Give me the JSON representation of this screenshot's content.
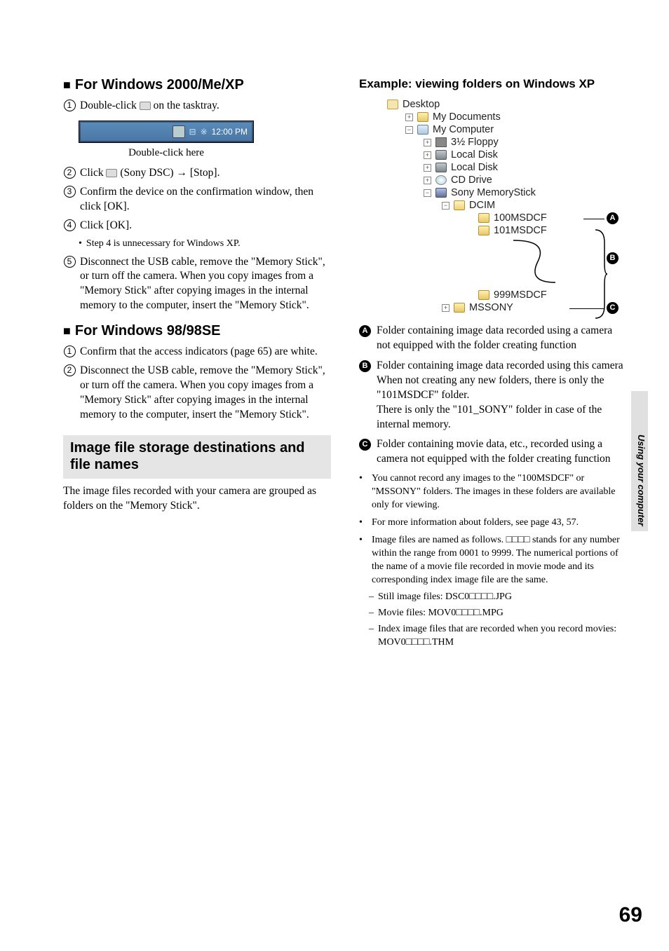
{
  "left": {
    "h1": "For Windows 2000/Me/XP",
    "s1": "Double-click",
    "s1b": "on the tasktray.",
    "tray_time": "12:00 PM",
    "tray_caption": "Double-click here",
    "s2a": "Click",
    "s2b": "(Sony DSC)",
    "s2c": "[Stop].",
    "s3": "Confirm the device on the confirmation window, then click [OK].",
    "s4": "Click [OK].",
    "s4note": "Step 4 is unnecessary for Windows XP.",
    "s5": "Disconnect the USB cable, remove the \"Memory Stick\", or turn off the camera. When you copy images from a \"Memory Stick\" after copying images in the internal memory to the computer, insert the \"Memory Stick\".",
    "h2": "For Windows 98/98SE",
    "w98_s1": "Confirm that the access indicators (page 65) are white.",
    "w98_s2": "Disconnect the USB cable, remove the \"Memory Stick\", or turn off the camera. When you copy images from a \"Memory Stick\" after copying images in the internal memory to the computer, insert the \"Memory Stick\".",
    "box_title": "Image file storage destinations and file names",
    "box_para": "The image files recorded with your camera are grouped as folders on the \"Memory Stick\"."
  },
  "right": {
    "example_h": "Example: viewing folders on Windows XP",
    "tree": {
      "desktop": "Desktop",
      "mydocs": "My Documents",
      "mycomp": "My Computer",
      "floppy": "3½ Floppy",
      "ld1": "Local Disk",
      "ld2": "Local Disk",
      "cd": "CD Drive",
      "ms": "Sony MemoryStick",
      "dcim": "DCIM",
      "f100": "100MSDCF",
      "f101": "101MSDCF",
      "f999": "999MSDCF",
      "mssony": "MSSONY"
    },
    "A": "Folder containing image data recorded using a camera not equipped with the folder creating function",
    "B1": "Folder containing image data recorded using this camera",
    "B2": "When not creating any new folders, there is only the \"101MSDCF\" folder.",
    "B3": "There is only the \"101_SONY\" folder in case of the internal memory.",
    "C": "Folder containing movie data, etc., recorded using a camera not equipped with the folder creating function",
    "b1": "You cannot record any images to the \"100MSDCF\" or \"MSSONY\" folders. The images in these folders are available only for viewing.",
    "b2": "For more information about folders, see page 43, 57.",
    "b3": "Image files are named as follows. □□□□ stands for any number within the range from 0001 to 9999. The numerical portions of the name of a movie file recorded in movie mode and its corresponding index image file are the same.",
    "d1": "Still image files: DSC0□□□□.JPG",
    "d2": "Movie files: MOV0□□□□.MPG",
    "d3": "Index image files that are recorded when you record movies: MOV0□□□□.THM"
  },
  "side": "Using your computer",
  "page": "69"
}
